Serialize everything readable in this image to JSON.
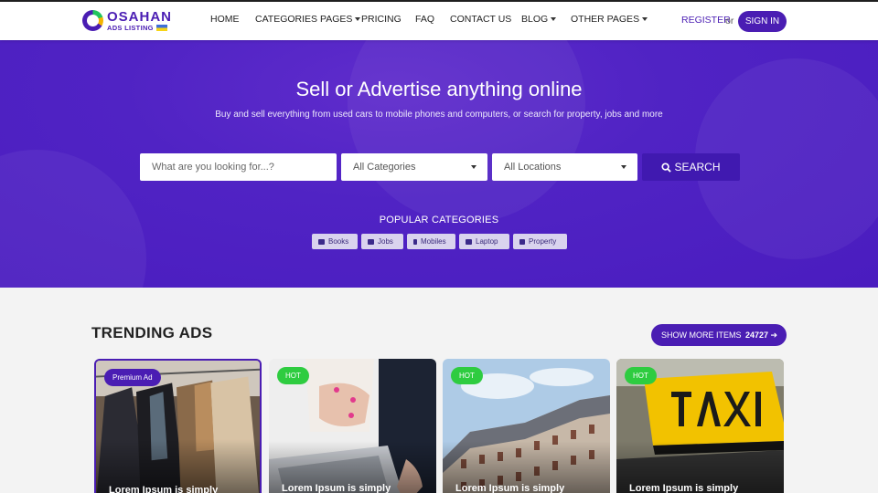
{
  "header": {
    "logo_main": "OSAHAN",
    "logo_sub": "ADS LISTING",
    "nav": [
      {
        "label": "HOME",
        "dropdown": false
      },
      {
        "label": "CATEGORIES PAGES",
        "dropdown": true
      },
      {
        "label": "PRICING",
        "dropdown": false
      },
      {
        "label": "FAQ",
        "dropdown": false
      },
      {
        "label": "CONTACT US",
        "dropdown": false
      },
      {
        "label": "BLOG",
        "dropdown": true
      },
      {
        "label": "OTHER PAGES",
        "dropdown": true
      }
    ],
    "register": "REGISTER",
    "or": "or",
    "signin": "SIGN IN"
  },
  "hero": {
    "title": "Sell or Advertise anything online",
    "subtitle": "Buy and sell everything from used cars to mobile phones and computers, or search for property, jobs and more",
    "search_placeholder": "What are you looking for...?",
    "category_select": "All Categories",
    "location_select": "All Locations",
    "search_button": "SEARCH",
    "popular_title": "POPULAR CATEGORIES",
    "popular": [
      {
        "label": "Books",
        "icon": "book-icon"
      },
      {
        "label": "Jobs",
        "icon": "briefcase-icon"
      },
      {
        "label": "Mobiles",
        "icon": "mobile-icon"
      },
      {
        "label": "Laptop",
        "icon": "laptop-icon"
      },
      {
        "label": "Property",
        "icon": "building-icon"
      }
    ]
  },
  "trending": {
    "title": "TRENDING ADS",
    "show_more": "SHOW MORE ITEMS",
    "count": "24727",
    "cards": [
      {
        "badge": "Premium Ad",
        "title": "Lorem Ipsum is simply"
      },
      {
        "badge": "HOT",
        "title": "Lorem Ipsum is simply"
      },
      {
        "badge": "HOT",
        "title": "Lorem Ipsum is simply"
      },
      {
        "badge": "HOT",
        "title": "Lorem Ipsum is simply"
      }
    ]
  },
  "colors": {
    "brand": "#4a1db3",
    "hot": "#2ecc40"
  }
}
